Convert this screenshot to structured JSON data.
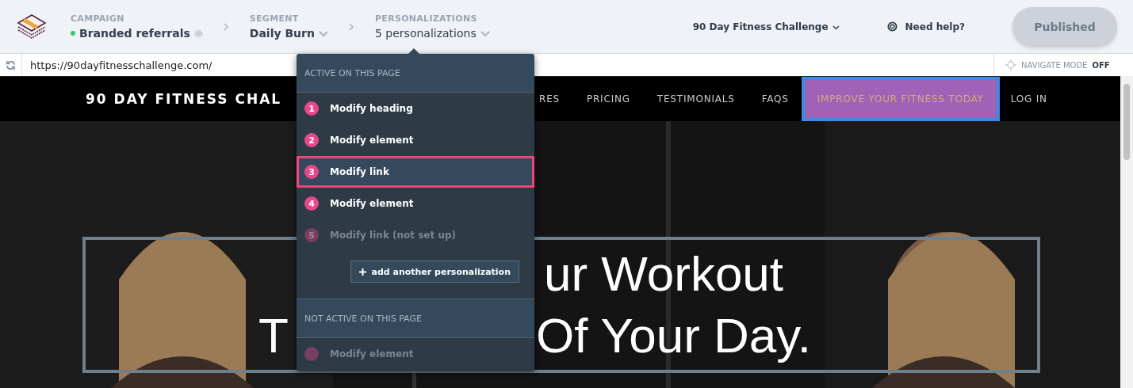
{
  "header": {
    "campaign": {
      "label": "CAMPAIGN",
      "value": "Branded referrals",
      "live": true
    },
    "segment": {
      "label": "SEGMENT",
      "value": "Daily Burn"
    },
    "personalizations": {
      "label": "PERSONALIZATIONS",
      "value": "5 personalizations"
    },
    "site": "90 Day Fitness Challenge",
    "help": "Need help?",
    "publish_button": {
      "label": "Published",
      "disabled": true
    }
  },
  "url_bar": {
    "url": "https://90dayfitnesschallenge.com/",
    "navigate_mode": {
      "label": "NAVIGATE MODE",
      "state": "OFF"
    }
  },
  "site_nav": {
    "brand": "90 DAY FITNESS CHAL",
    "links": [
      {
        "label": "RES",
        "highlighted": false
      },
      {
        "label": "PRICING",
        "highlighted": false
      },
      {
        "label": "TESTIMONIALS",
        "highlighted": false
      },
      {
        "label": "FAQS",
        "highlighted": false
      },
      {
        "label": "IMPROVE YOUR FITNESS TODAY",
        "highlighted": true
      },
      {
        "label": "LOG IN",
        "highlighted": false
      }
    ]
  },
  "hero": {
    "line_1": "ur Workout",
    "line_2_left": "T",
    "line_2_right": "Of Your Day."
  },
  "menu": {
    "active_heading": "ACTIVE ON THIS PAGE",
    "active_items": [
      {
        "number": "1",
        "label": "Modify heading",
        "selected": false,
        "disabled": false
      },
      {
        "number": "2",
        "label": "Modify element",
        "selected": false,
        "disabled": false
      },
      {
        "number": "3",
        "label": "Modify link",
        "selected": true,
        "disabled": false
      },
      {
        "number": "4",
        "label": "Modify element",
        "selected": false,
        "disabled": false
      },
      {
        "number": "5",
        "label": "Modify link (not set up)",
        "selected": false,
        "disabled": true
      }
    ],
    "add_button": "add another personalization",
    "inactive_heading": "NOT ACTIVE ON THIS PAGE",
    "inactive_items": [
      {
        "label": "Modify element",
        "selected": false,
        "disabled": true
      }
    ]
  }
}
